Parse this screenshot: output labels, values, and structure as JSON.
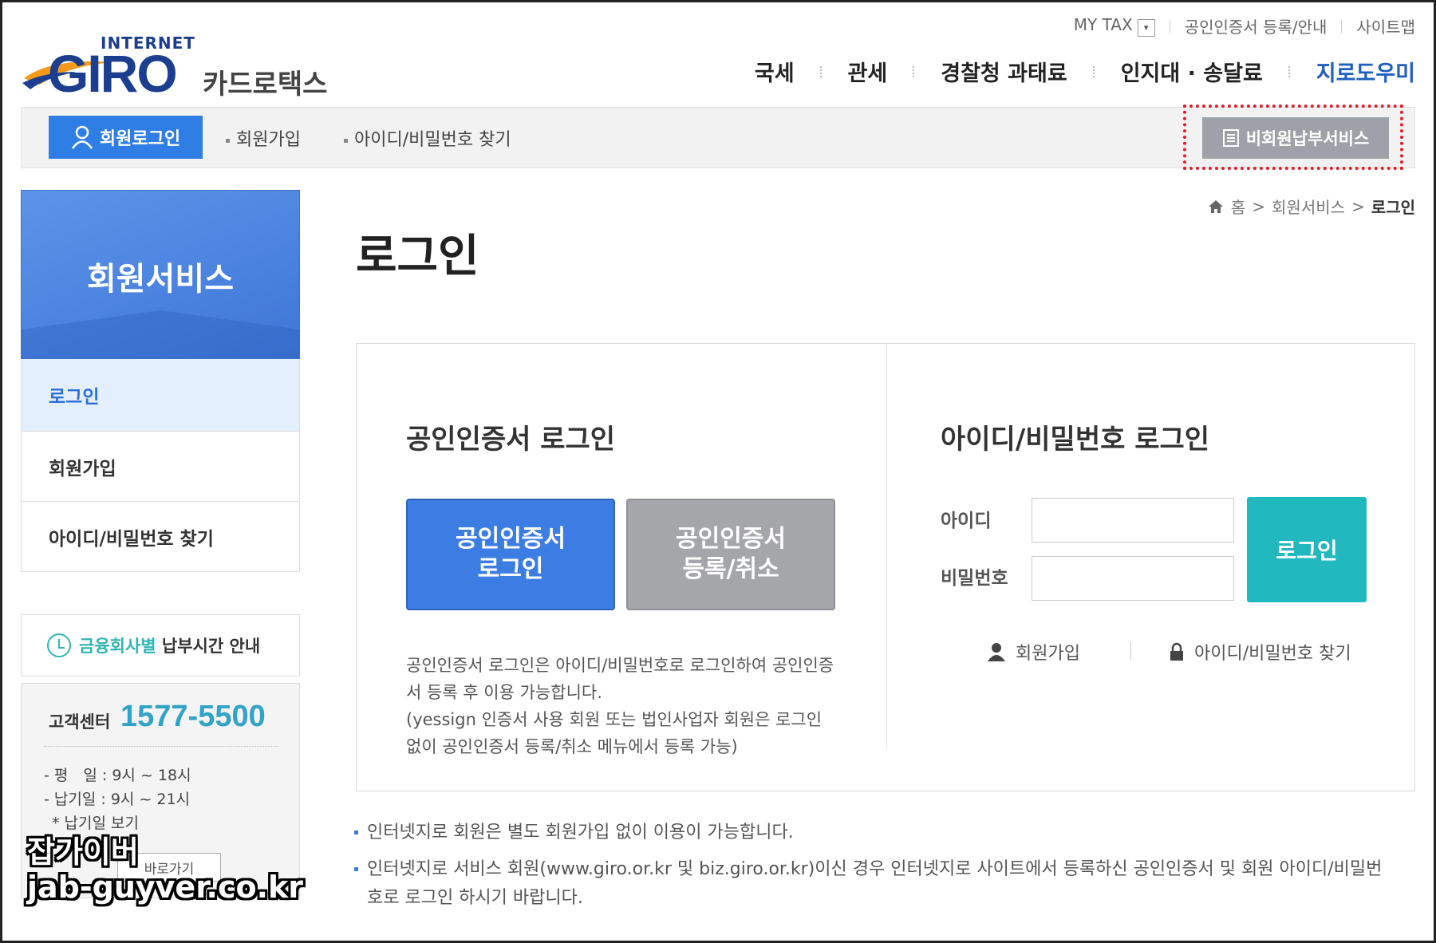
{
  "util": {
    "mytax": "MY TAX",
    "cert_register": "공인인증서 등록/안내",
    "sitemap": "사이트맵"
  },
  "logo": {
    "internet": "INTERNET",
    "giro": "GIRO",
    "cardtax": "카드로택스"
  },
  "gnb": [
    "국세",
    "관세",
    "경찰청 과태료",
    "인지대 · 송달료",
    "지로도우미"
  ],
  "memberbar": {
    "login_button": "회원로그인",
    "join": "회원가입",
    "find": "아이디/비밀번호 찾기",
    "nonmember": "비회원납부서비스"
  },
  "sidebar": {
    "title": "회원서비스",
    "menu": [
      "로그인",
      "회원가입",
      "아이디/비밀번호 찾기"
    ],
    "paytime_accent": "금융회사별",
    "paytime_rest": "납부시간 안내",
    "cs_label": "고객센터",
    "cs_phone": "1577-5500",
    "cs_weekday": "- 평　일 : 9시 ~ 18시",
    "cs_dueday": "- 납기일 : 9시 ~ 21시",
    "cs_view": "* 납기일 보기",
    "cs_button": "바로가기"
  },
  "watermark": {
    "line1": "잡가이버",
    "line2": "jab-guyver.co.kr"
  },
  "breadcrumb": {
    "home": "홈",
    "level1": "회원서비스",
    "current": "로그인"
  },
  "page_title": "로그인",
  "cert": {
    "heading": "공인인증서 로그인",
    "login_btn_line1": "공인인증서",
    "login_btn_line2": "로그인",
    "register_btn_line1": "공인인증서",
    "register_btn_line2": "등록/취소",
    "desc1": "공인인증서 로그인은 아이디/비밀번호로 로그인하여 공인인증서 등록 후 이용 가능합니다.",
    "desc2": "(yessign 인증서 사용 회원 또는 법인사업자 회원은 로그인 없이 공인인증서 등록/취소 메뉴에서 등록 가능)"
  },
  "idlogin": {
    "heading": "아이디/비밀번호 로그인",
    "id_label": "아이디",
    "pw_label": "비밀번호",
    "id_value": "",
    "pw_value": "",
    "login_button": "로그인",
    "join_link": "회원가입",
    "find_link": "아이디/비밀번호 찾기"
  },
  "notes": [
    "인터넷지로 회원은 별도 회원가입 없이 이용이 가능합니다.",
    "인터넷지로 서비스 회원(www.giro.or.kr 및 biz.giro.or.kr)이신 경우 인터넷지로 사이트에서 등록하신 공인인증서 및 회원 아이디/비밀번호로 로그인 하시기 바랍니다."
  ],
  "colors": {
    "primary_blue": "#3c7de3",
    "teal": "#22b8c0",
    "highlight_red": "#e01e2b",
    "nav_accent": "#1f5fbf"
  }
}
